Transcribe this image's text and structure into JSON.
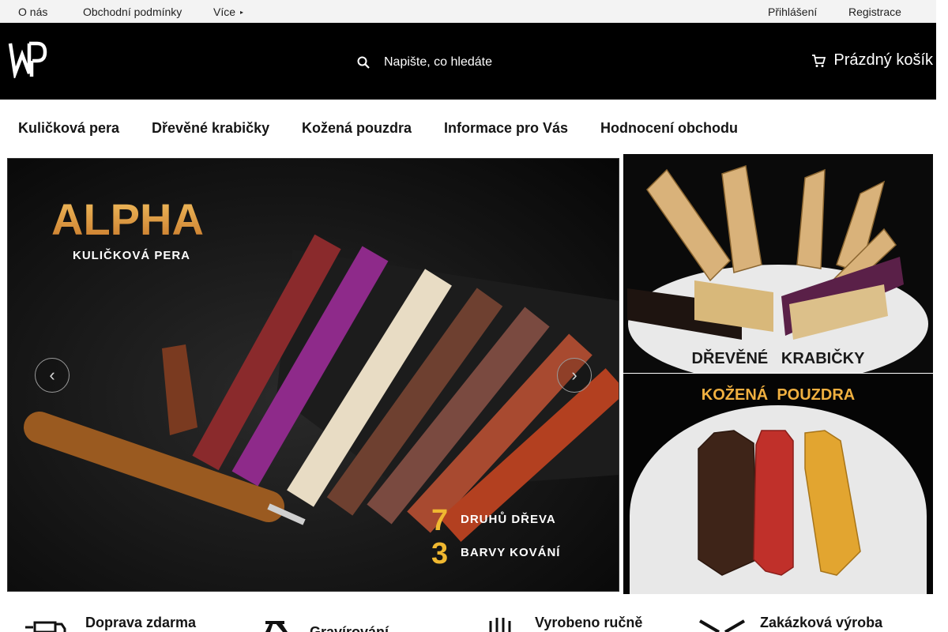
{
  "topbar": {
    "links": [
      "O nás",
      "Obchodní podmínky",
      "Více"
    ],
    "more_caret": "▸",
    "account": [
      "Přihlášení",
      "Registrace"
    ]
  },
  "header": {
    "logo_text": "WP",
    "search_placeholder": "Napište, co hledáte",
    "cart_label": "Prázdný košík"
  },
  "nav": {
    "items": [
      "Kuličková pera",
      "Dřevěné krabičky",
      "Kožená pouzdra",
      "Informace pro Vás",
      "Hodnocení obchodu"
    ]
  },
  "slider": {
    "title": "ALPHA",
    "subtitle": "KULIČKOVÁ PERA",
    "line1_num": "7",
    "line1_text": "DRUHŮ DŘEVA",
    "line2_num": "3",
    "line2_text": "BARVY KOVÁNÍ",
    "prev_icon": "‹",
    "next_icon": "›"
  },
  "banner_boxes": {
    "caption": "DŘEVĚNÉ   KRABIČKY"
  },
  "banner_cases": {
    "caption": "KOŽENÁ  POUZDRA"
  },
  "features": [
    {
      "label": "Doprava zdarma",
      "icon": "truck-icon"
    },
    {
      "label": "Gravírování",
      "icon": "engraving-icon"
    },
    {
      "label": "Vyrobeno ručně",
      "icon": "hand-icon"
    },
    {
      "label": "Zakázková výroba",
      "icon": "tools-icon"
    }
  ],
  "colors": {
    "header_bg": "#000000",
    "topbar_bg": "#f3f3f3",
    "alpha_gold": "#e0a040"
  }
}
